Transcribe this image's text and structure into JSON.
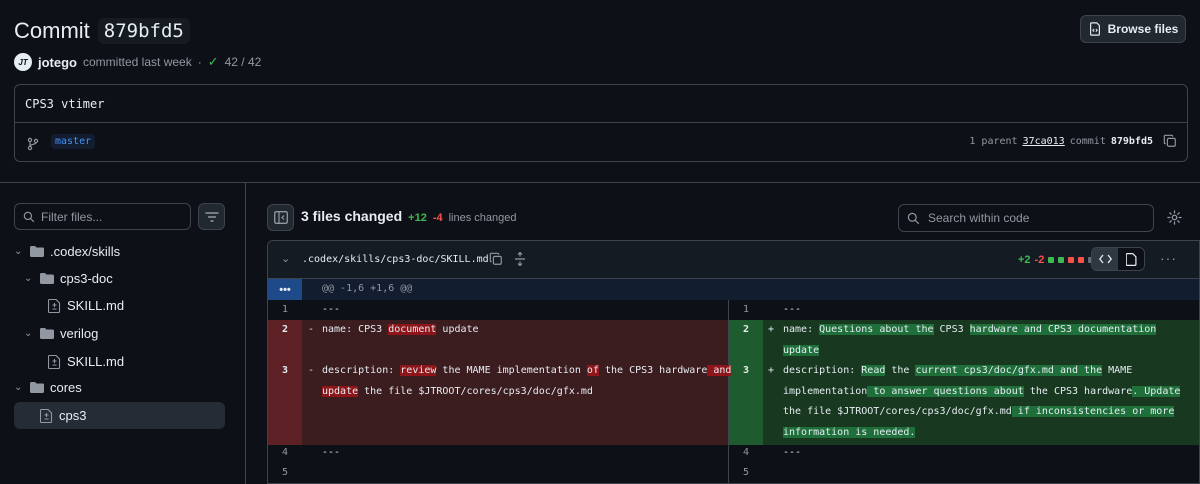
{
  "header": {
    "title_word": "Commit",
    "title_sha": "879bfd5",
    "browse_label": "Browse files",
    "author": "jotego",
    "committed": "committed last week",
    "dot": "·",
    "checks": "42 / 42",
    "avatar_text": "JT"
  },
  "commit": {
    "message": "CPS3 vtimer",
    "branch": "master",
    "parent_label": "1 parent",
    "parent_sha": "37ca013",
    "commit_label": "commit",
    "commit_sha": "879bfd5"
  },
  "sidebar": {
    "filter_placeholder": "Filter files...",
    "tree": [
      {
        "label": ".codex/skills",
        "type": "folder"
      },
      {
        "label": "cps3-doc",
        "type": "folder"
      },
      {
        "label": "SKILL.md",
        "type": "file"
      },
      {
        "label": "verilog",
        "type": "folder"
      },
      {
        "label": "SKILL.md",
        "type": "file"
      },
      {
        "label": "cores",
        "type": "folder"
      },
      {
        "label": "cps3",
        "type": "file"
      }
    ]
  },
  "main": {
    "files_changed": "3 files changed",
    "additions": "+12",
    "deletions": "-4",
    "lines_changed": "lines changed",
    "search_placeholder": "Search within code"
  },
  "diff": {
    "path": ".codex/skills/cps3-doc/SKILL.md",
    "add": "+2",
    "del": "-2",
    "hunk": "@@ -1,6 +1,6 @@",
    "hunk_btn": "•••",
    "left": {
      "l1_num": "1",
      "l1_text": "---",
      "l2_num": "2",
      "l2_sign": "-",
      "l2_a": "name: CPS3 ",
      "l2_b": "document",
      "l2_c": " update",
      "l3_num": "3",
      "l3_sign": "-",
      "l3_a": "description: ",
      "l3_b": "review",
      "l3_c": " the MAME implementation ",
      "l3_d": "of",
      "l3_e": " the CPS3 hardware",
      "l3_f": " and",
      "l3_g": "update",
      "l3_h": " the file $JTROOT/cores/cps3/doc/gfx.md",
      "l4_num": "4",
      "l4_text": "---",
      "l5_num": "5"
    },
    "right": {
      "l1_num": "1",
      "l1_text": "---",
      "l2_num": "2",
      "l2_sign": "+",
      "l2_a": "name: ",
      "l2_b": "Questions about the",
      "l2_c": " CPS3 ",
      "l2_d": "hardware and CPS3 documentation",
      "l2_e": "update",
      "l3_num": "3",
      "l3_sign": "+",
      "l3_a": "description: ",
      "l3_b": "Read",
      "l3_c": " the ",
      "l3_d": "current cps3/doc/gfx.md and the",
      "l3_e": " MAME",
      "l3_f": "implementation",
      "l3_g": " to answer questions about",
      "l3_h": " the CPS3 hardware",
      "l3_i": ". Update",
      "l3_j": "the file $JTROOT/cores/cps3/doc/gfx.md",
      "l3_k": " if inconsistencies or more",
      "l3_l": "information is needed.",
      "l4_num": "4",
      "l4_text": "---",
      "l5_num": "5"
    }
  },
  "colors": {
    "bg": "#0d1117",
    "add_green": "#3fb950",
    "del_red": "#f85149",
    "link_blue": "#4493f8"
  }
}
